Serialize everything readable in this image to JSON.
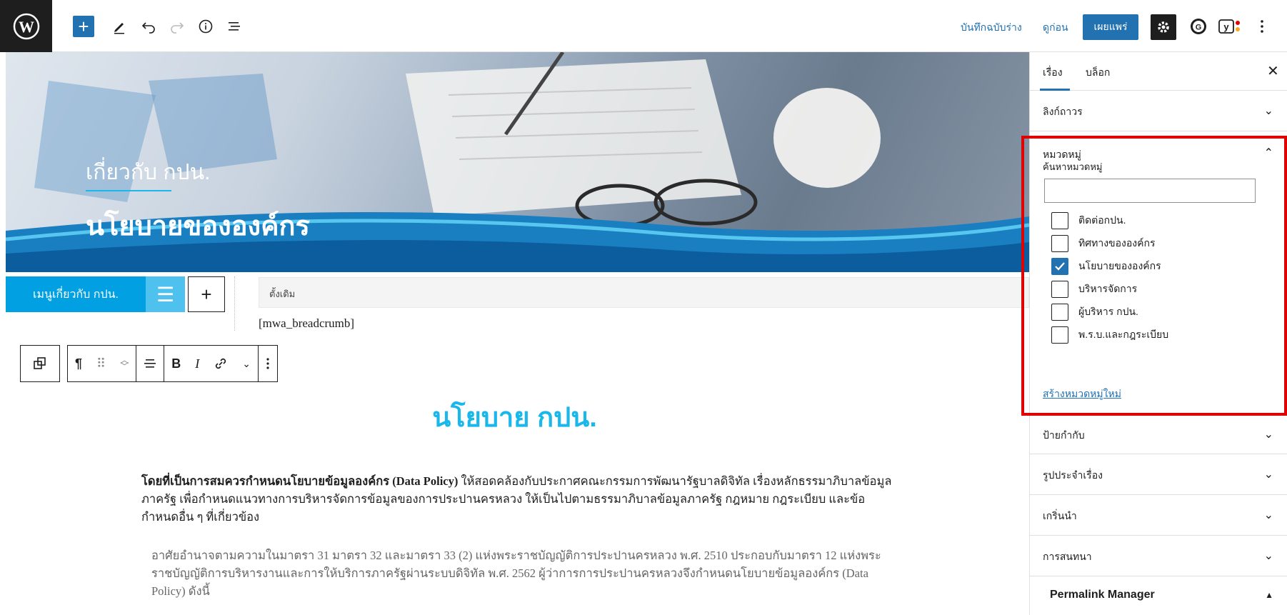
{
  "toolbar": {
    "save_draft": "บันทึกฉบับร่าง",
    "preview": "ดูก่อน",
    "publish": "เผยแพร่",
    "brand_color": "#2271b1"
  },
  "hero": {
    "subtitle": "เกี่ยวกับ กปน.",
    "title": "นโยบายขององค์กร"
  },
  "menu_block": {
    "label": "เมนูเกี่ยวกับ กปน."
  },
  "template_bar": {
    "label": "ตั้งเดิม"
  },
  "shortcode": "[mwa_breadcrumb]",
  "content": {
    "heading": "นโยบาย กปน.",
    "para1_bold": "โดยที่เป็นการสมควรกำหนดนโยบายข้อมูลองค์กร (Data Policy)",
    "para1_rest": " ให้สอดคล้องกับประกาศคณะกรรมการพัฒนารัฐบาลดิจิทัล เรื่องหลักธรรมาภิบาลข้อมูลภาครัฐ เพื่อกำหนดแนวทางการบริหารจัดการข้อมูลของการประปานครหลวง ให้เป็นไปตามธรรมาภิบาลข้อมูลภาครัฐ กฎหมาย กฎระเบียบ และข้อกำหนดอื่น ๆ ที่เกี่ยวข้อง",
    "para2": "อาศัยอำนาจตามความในมาตรา 31 มาตรา 32 และมาตรา 33 (2) แห่งพระราชบัญญัติการประปานครหลวง พ.ศ. 2510 ประกอบกับมาตรา 12 แห่งพระราชบัญญัติการบริหารงานและการให้บริการภาครัฐผ่านระบบดิจิทัล พ.ศ. 2562 ผู้ว่าการการประปานครหลวงจึงกำหนดนโยบายข้อมูลองค์กร (Data Policy) ดังนี้"
  },
  "sidebar": {
    "tab_post": "เรื่อง",
    "tab_block": "บล็อก",
    "permalink": "ลิงก์ถาวร",
    "categories": "หมวดหมู่",
    "search_categories": "ค้นหาหมวดหมู่",
    "category_items": [
      {
        "label": "ติดต่อกปน.",
        "checked": false
      },
      {
        "label": "ทิศทางขององค์กร",
        "checked": false
      },
      {
        "label": "นโยบายขององค์กร",
        "checked": true
      },
      {
        "label": "บริหารจัดการ",
        "checked": false
      },
      {
        "label": "ผู้บริหาร กปน.",
        "checked": false
      },
      {
        "label": "พ.ร.บ.และกฎระเบียบ",
        "checked": false
      }
    ],
    "add_new_category": "สร้างหมวดหมู่ใหม่",
    "tags": "ป้ายกำกับ",
    "featured_image": "รูปประจำเรื่อง",
    "excerpt": "เกริ่นนำ",
    "discussion": "การสนทนา",
    "permalink_manager": "Permalink Manager"
  },
  "highlight_color": "#e10000"
}
